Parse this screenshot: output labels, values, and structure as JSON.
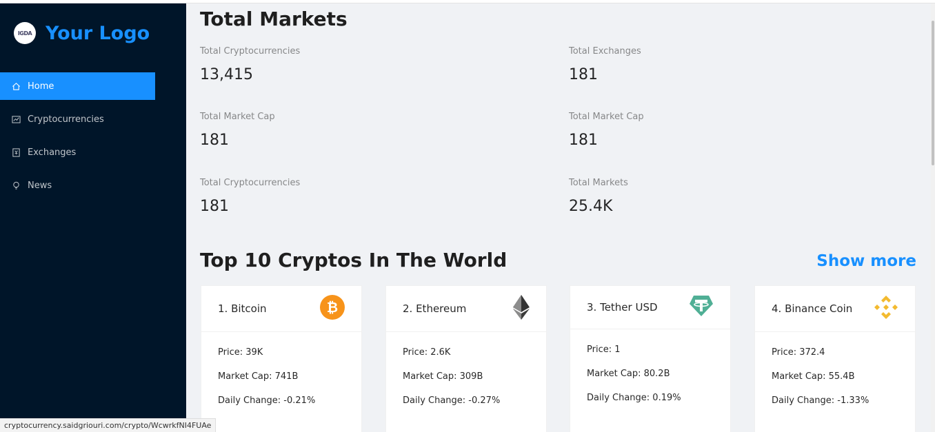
{
  "sidebar": {
    "logo_text": "Your Logo",
    "logo_img_text": "IGDA",
    "items": [
      {
        "label": "Home",
        "icon": "home-icon",
        "active": true
      },
      {
        "label": "Cryptocurrencies",
        "icon": "fund-icon",
        "active": false
      },
      {
        "label": "Exchanges",
        "icon": "money-collect-icon",
        "active": false
      },
      {
        "label": "News",
        "icon": "bulb-icon",
        "active": false
      }
    ]
  },
  "main": {
    "title": "Total Markets",
    "stats": [
      {
        "title": "Total Cryptocurrencies",
        "value": "13,415"
      },
      {
        "title": "Total Exchanges",
        "value": "181"
      },
      {
        "title": "Total Market Cap",
        "value": "181"
      },
      {
        "title": "Total Market Cap",
        "value": "181"
      },
      {
        "title": "Total Cryptocurrencies",
        "value": "181"
      },
      {
        "title": "Total Markets",
        "value": "25.4K"
      }
    ],
    "section_title": "Top 10 Cryptos In The World",
    "show_more": "Show more",
    "cards": [
      {
        "title": "1. Bitcoin",
        "price": "Price: 39K",
        "market_cap": "Market Cap: 741B",
        "change": "Daily Change: -0.21%",
        "icon": "bitcoin-icon"
      },
      {
        "title": "2. Ethereum",
        "price": "Price: 2.6K",
        "market_cap": "Market Cap: 309B",
        "change": "Daily Change: -0.27%",
        "icon": "ethereum-icon"
      },
      {
        "title": "3. Tether USD",
        "price": "Price: 1",
        "market_cap": "Market Cap: 80.2B",
        "change": "Daily Change: 0.19%",
        "icon": "tether-icon"
      },
      {
        "title": "4. Binance Coin",
        "price": "Price: 372.4",
        "market_cap": "Market Cap: 55.4B",
        "change": "Daily Change: -1.33%",
        "icon": "binance-icon"
      }
    ]
  },
  "status_url": "cryptocurrency.saidgriouri.com/crypto/WcwrkfNI4FUAe",
  "colors": {
    "sidebar_bg": "#001529",
    "accent": "#1890ff",
    "page_bg": "#f0f2f5"
  }
}
